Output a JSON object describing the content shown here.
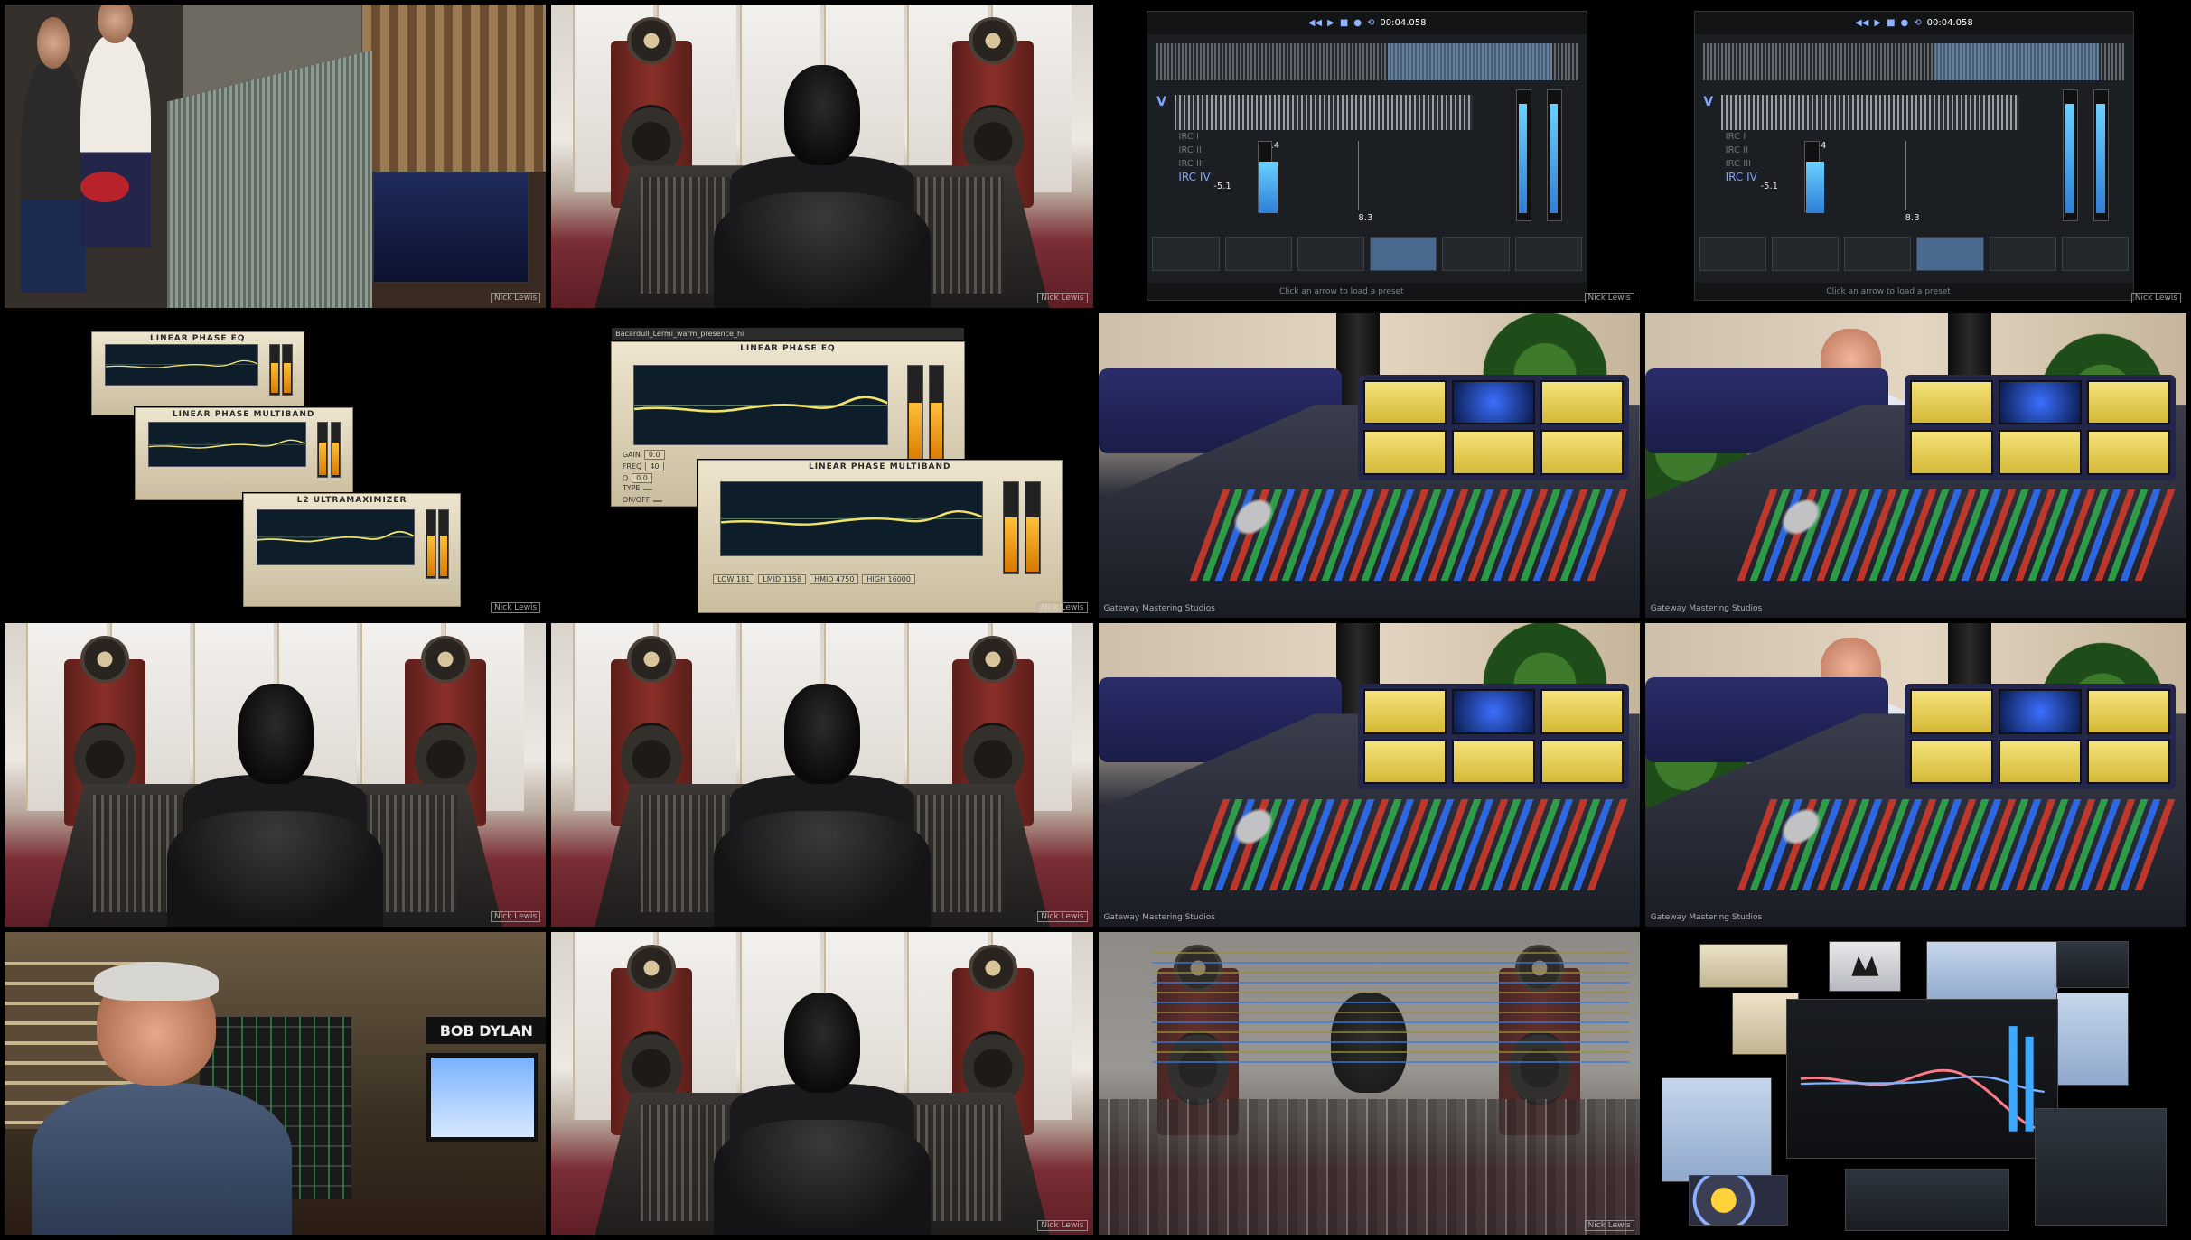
{
  "grid": {
    "tiles": [
      {
        "id": 1,
        "type": "recording-studio"
      },
      {
        "id": 2,
        "type": "engineer-back-view"
      },
      {
        "id": 3,
        "type": "ozone-ui",
        "timecode": "00:04.058",
        "irc": [
          "IRC I",
          "IRC II",
          "IRC III",
          "IRC IV"
        ],
        "selected_irc": "IRC IV",
        "readout_a": "-0.4",
        "readout_b": "-5.1",
        "readout_c": "8.3",
        "status": "Click an arrow to load a preset"
      },
      {
        "id": 4,
        "type": "ozone-ui",
        "timecode": "00:04.058",
        "irc": [
          "IRC I",
          "IRC II",
          "IRC III",
          "IRC IV"
        ],
        "selected_irc": "IRC IV",
        "readout_a": "-0.4",
        "readout_b": "-5.1",
        "readout_c": "8.3",
        "status": "Click an arrow to load a preset"
      },
      {
        "id": 5,
        "type": "waves-plugins-small",
        "titles": [
          "LINEAR PHASE EQ",
          "LINEAR PHASE MULTIBAND",
          "L2 ULTRAMAXIMIZER"
        ]
      },
      {
        "id": 6,
        "type": "waves-plugins-large",
        "titles": [
          "LINEAR PHASE EQ",
          "LINEAR PHASE MULTIBAND"
        ],
        "toolbar_label": "Bacardull_Lermi_warm_presence_hi",
        "rows": [
          {
            "label": "GAIN",
            "value": "0.0"
          },
          {
            "label": "FREQ",
            "value": "40"
          },
          {
            "label": "Q",
            "value": "0.0"
          },
          {
            "label": "TYPE",
            "value": ""
          },
          {
            "label": "ON/OFF",
            "value": ""
          }
        ],
        "xovers": [
          "LOW 181",
          "LMID 1158",
          "HMID 4750",
          "HIGH 16000"
        ]
      },
      {
        "id": 7,
        "type": "mastering-console",
        "caption": "Gateway Mastering Studios"
      },
      {
        "id": 8,
        "type": "presenter-office",
        "caption": "Gateway Mastering Studios"
      },
      {
        "id": 9,
        "type": "engineer-back-view"
      },
      {
        "id": 10,
        "type": "engineer-back-view"
      },
      {
        "id": 11,
        "type": "mastering-console",
        "caption": "Gateway Mastering Studios"
      },
      {
        "id": 12,
        "type": "presenter-office",
        "caption": "Gateway Mastering Studios"
      },
      {
        "id": 13,
        "type": "engineer-smiling",
        "sign": "BOB DYLAN"
      },
      {
        "id": 14,
        "type": "engineer-back-view"
      },
      {
        "id": 15,
        "type": "daw-overlay"
      },
      {
        "id": 16,
        "type": "plugin-collage"
      }
    ]
  },
  "watermark": "Nick Lewis"
}
